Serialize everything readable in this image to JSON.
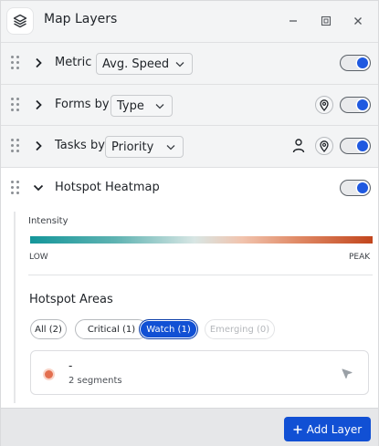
{
  "window": {
    "title": "Map Layers",
    "controls": [
      "minimize-icon",
      "restore-icon",
      "close-icon"
    ]
  },
  "layers": [
    {
      "label": "Metric",
      "select_value": "Avg. Speed",
      "expanded": false,
      "enabled": true
    },
    {
      "label": "Forms by",
      "select_value": "Type",
      "expanded": false,
      "enabled": true,
      "icons": [
        "pin-icon"
      ]
    },
    {
      "label": "Tasks by",
      "select_value": "Priority",
      "expanded": false,
      "enabled": true,
      "icons": [
        "person-icon",
        "pin-icon"
      ]
    },
    {
      "label": "Hotspot Heatmap",
      "expanded": true,
      "enabled": true
    }
  ],
  "heatmap": {
    "intensity_label": "Intensity",
    "low_label": "LOW",
    "peak_label": "PEAK",
    "gradient_colors": [
      "#14969a",
      "#5fb3b2",
      "#d8e6e4",
      "#f1c3ad",
      "#e08a66",
      "#c2461d"
    ],
    "areas_title": "Hotspot Areas",
    "filters": [
      {
        "label": "All (2)",
        "state": "default"
      },
      {
        "label": "Critical (1)",
        "state": "default"
      },
      {
        "label": "Watch (1)",
        "state": "active"
      },
      {
        "label": "Emerging (0)",
        "state": "disabled"
      }
    ],
    "areas": [
      {
        "name": "-",
        "detail": "2 segments",
        "color": "#e36f4f"
      }
    ]
  },
  "footer": {
    "add_button_label": "Add Layer",
    "add_button_icon": "plus-icon"
  },
  "colors": {
    "accent": "#1150d4",
    "toggle_on": "#1f59e0"
  }
}
